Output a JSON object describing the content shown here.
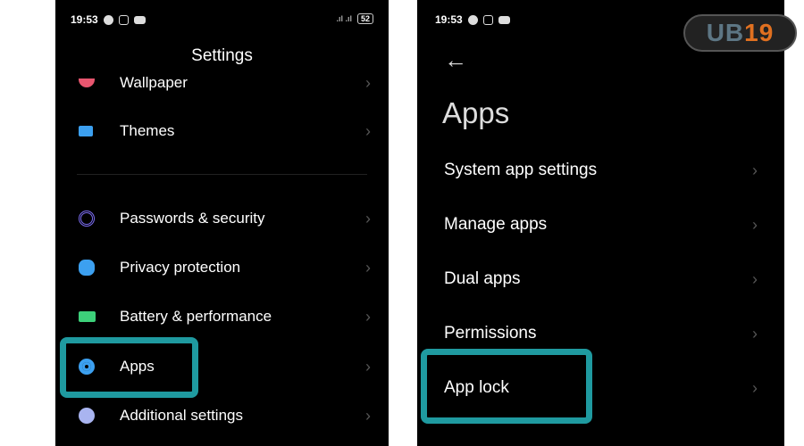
{
  "left": {
    "time": "19:53",
    "battery": "52",
    "title": "Settings",
    "items": [
      {
        "label": "Wallpaper",
        "icon": "wallpaper-icon",
        "color": "#e8566f"
      },
      {
        "label": "Themes",
        "icon": "themes-icon",
        "color": "#3ca0f0"
      },
      {
        "label": "Passwords & security",
        "icon": "fingerprint-icon",
        "color": "#7b6cf0"
      },
      {
        "label": "Privacy protection",
        "icon": "privacy-shield-icon",
        "color": "#3ca0f0"
      },
      {
        "label": "Battery & performance",
        "icon": "battery-icon",
        "color": "#3dd07a"
      },
      {
        "label": "Apps",
        "icon": "gear-icon",
        "color": "#3ca0f0"
      },
      {
        "label": "Additional settings",
        "icon": "more-icon",
        "color": "#a9b4f0"
      }
    ]
  },
  "right": {
    "time": "19:53",
    "title": "Apps",
    "items": [
      {
        "label": "System app settings"
      },
      {
        "label": "Manage apps"
      },
      {
        "label": "Dual apps"
      },
      {
        "label": "Permissions"
      },
      {
        "label": "App lock"
      }
    ]
  },
  "logo": {
    "text": "UB19"
  },
  "highlight_color": "#1f9aa0"
}
